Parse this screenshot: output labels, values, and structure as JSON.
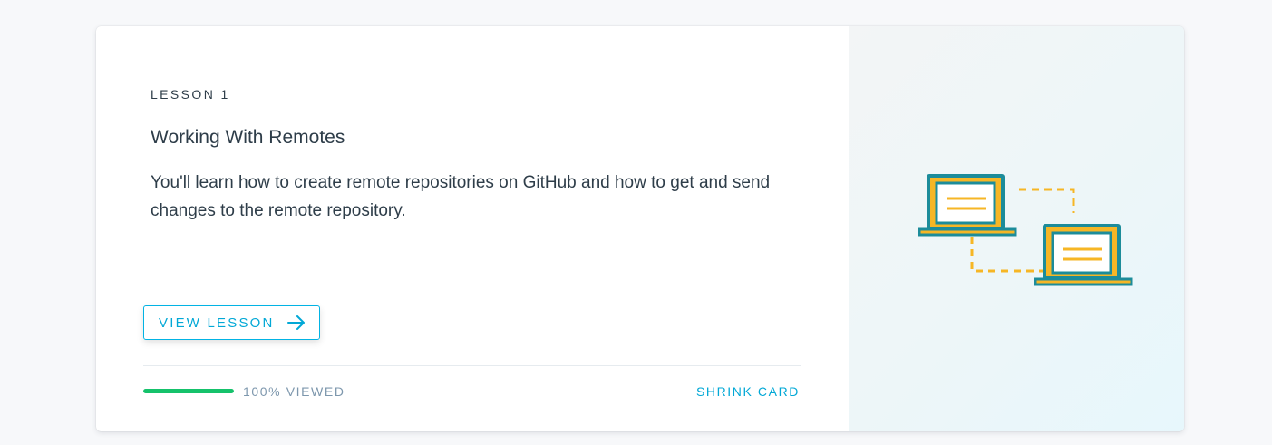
{
  "lesson": {
    "eyebrow": "LESSON 1",
    "title": "Working With Remotes",
    "description": "You'll learn how to create remote repositories on GitHub and how to get and send changes to the remote repository."
  },
  "actions": {
    "view_lesson_label": "VIEW LESSON",
    "view_lesson_icon": "arrow-right-icon",
    "shrink_label": "SHRINK CARD"
  },
  "progress": {
    "percent": 100,
    "label": "100% VIEWED"
  },
  "illustration": {
    "icon": "laptops-connected-icon"
  },
  "colors": {
    "accent": "#02b3e4",
    "progress": "#15c26b",
    "text": "#2e3d49",
    "muted": "#7d97ad",
    "laptop_frame": "#1c8c9a",
    "laptop_accent": "#f6b625"
  }
}
